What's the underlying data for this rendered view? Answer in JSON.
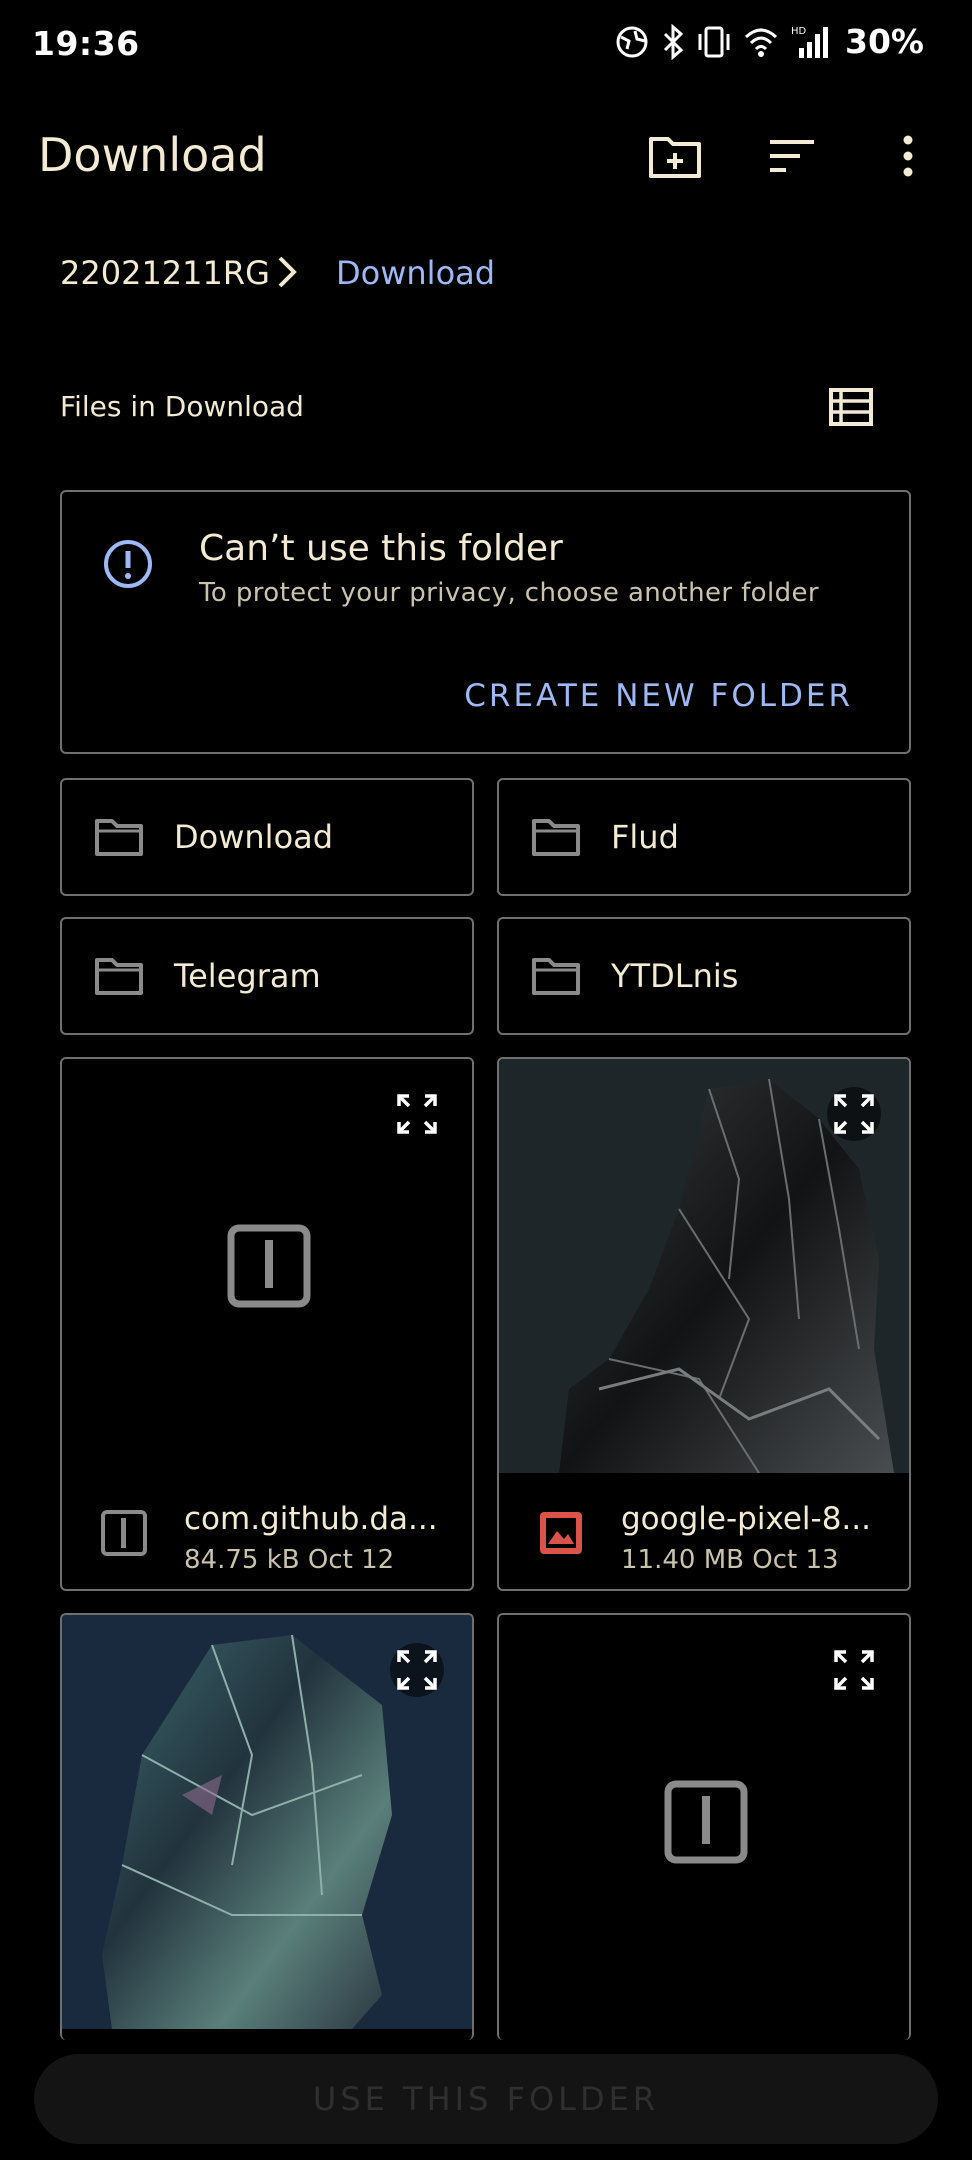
{
  "status_bar": {
    "time": "19:36",
    "battery": "30%",
    "icons": [
      "vpn-globe-icon",
      "bluetooth-icon",
      "vibrate-icon",
      "wifi-icon",
      "hd-signal-icon"
    ]
  },
  "app_bar": {
    "title": "Download",
    "actions": [
      "new-folder-icon",
      "sort-icon",
      "more-vert-icon"
    ]
  },
  "breadcrumb": {
    "root": "22021211RG",
    "current": "Download"
  },
  "section": {
    "header": "Files in Download"
  },
  "warning": {
    "title": "Can’t use this folder",
    "subtitle": "To protect your privacy, choose another folder",
    "action": "CREATE NEW FOLDER"
  },
  "folders": [
    {
      "name": "Download"
    },
    {
      "name": "Flud"
    },
    {
      "name": "Telegram"
    },
    {
      "name": "YTDLnis"
    }
  ],
  "files": [
    {
      "name": "com.github.da...",
      "size": "84.75 kB",
      "date": "Oct 12",
      "icon": "archive-icon"
    },
    {
      "name": "google-pixel-8...",
      "size": "11.40 MB",
      "date": "Oct 13",
      "icon": "image-icon"
    }
  ],
  "bottom_button": {
    "label": "USE THIS FOLDER"
  },
  "colors": {
    "background": "#000000",
    "text": "#f2ead2",
    "accent": "#9db8f5",
    "border": "#6f6f6f",
    "image_icon": "#d9534a"
  }
}
